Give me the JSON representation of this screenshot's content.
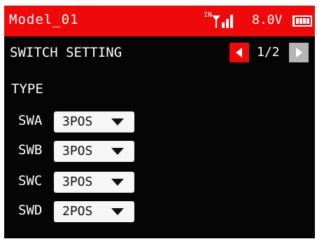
{
  "status_bar": {
    "model_name": "Model_01",
    "signal_label": "IN",
    "voltage": "8.0V",
    "signal_icon": "signal-bars-icon",
    "battery_icon": "battery-icon"
  },
  "header": {
    "title": "SWITCH SETTING",
    "page": "1/2",
    "prev_icon": "arrow-left-icon",
    "next_icon": "arrow-right-icon"
  },
  "section": {
    "label": "TYPE"
  },
  "switches": [
    {
      "name": "SWA",
      "value": "3POS"
    },
    {
      "name": "SWB",
      "value": "3POS"
    },
    {
      "name": "SWC",
      "value": "3POS"
    },
    {
      "name": "SWD",
      "value": "2POS"
    }
  ],
  "colors": {
    "accent": "#ee0a0a",
    "background": "#050505",
    "inactive_button": "#b5b5b5",
    "dropdown_bg": "#f6f6f6"
  }
}
